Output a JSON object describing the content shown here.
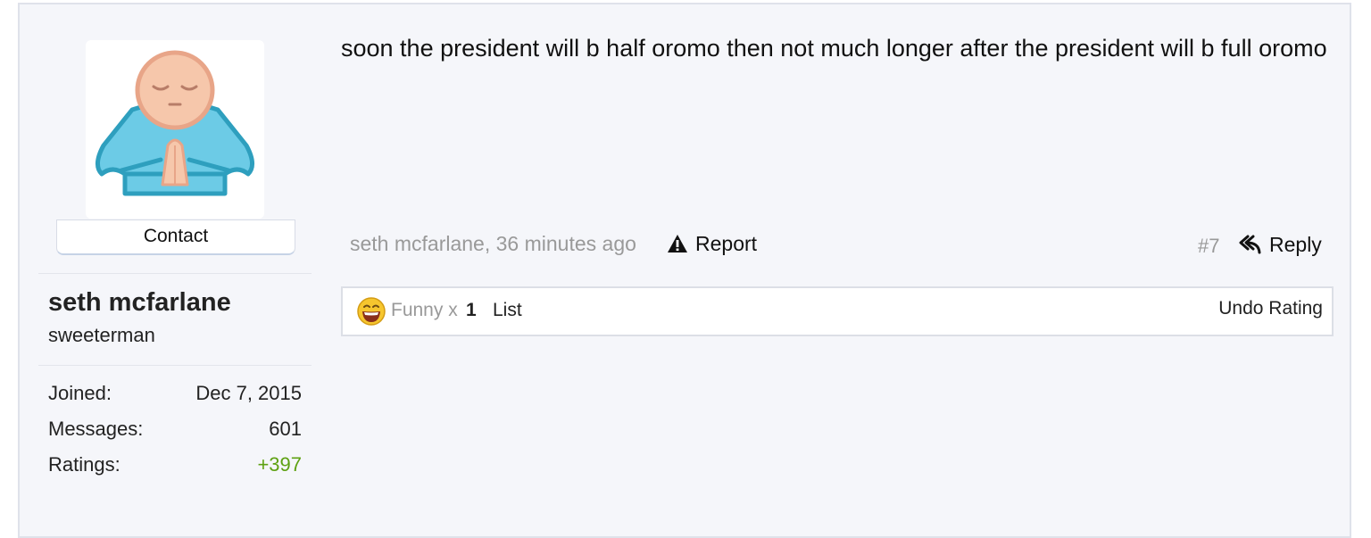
{
  "user": {
    "avatar_icon": "praying-person-icon",
    "contact_label": "Contact",
    "username": "seth mcfarlane",
    "user_title": "sweeterman",
    "stats": [
      {
        "label": "Joined:",
        "value": "Dec 7, 2015"
      },
      {
        "label": "Messages:",
        "value": "601"
      },
      {
        "label": "Ratings:",
        "value": "+397"
      }
    ],
    "ratings_color": "#5ea112"
  },
  "message": {
    "text": "soon the president will b half oromo then not much longer after the president will b full oromo"
  },
  "meta": {
    "author_time": "seth mcfarlane, 36 minutes ago",
    "report_icon": "warning-icon",
    "report_label": "Report",
    "post_number": "#7",
    "reply_icon": "reply-arrow-icon",
    "reply_label": "Reply"
  },
  "ratings_bar": {
    "emoji_icon": "laughing-face-icon",
    "rating_name": "Funny x",
    "rating_count": "1",
    "list_label": "List",
    "undo_label": "Undo Rating"
  }
}
